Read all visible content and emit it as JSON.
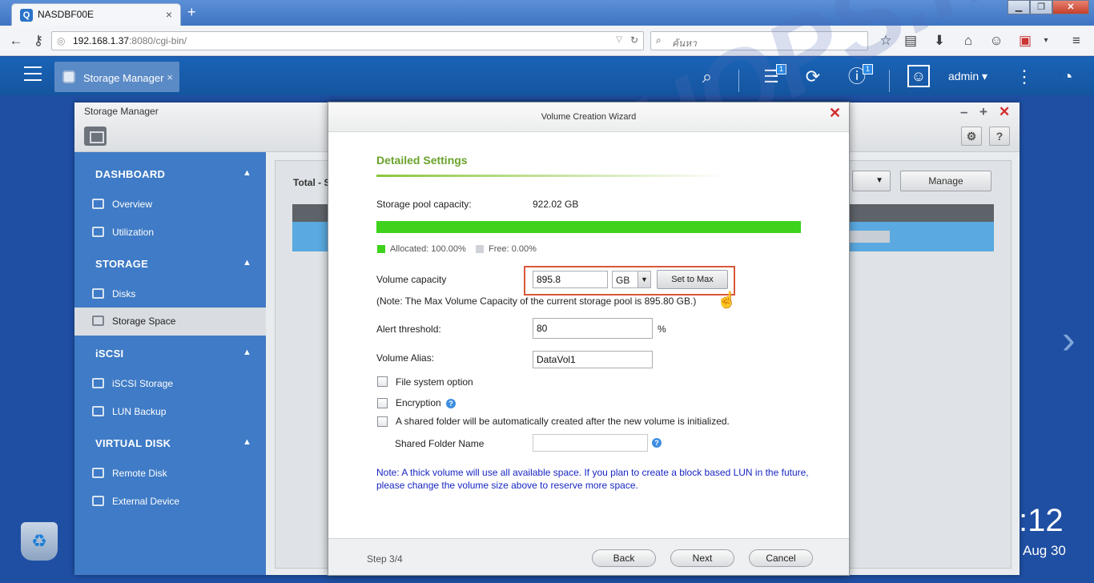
{
  "browser": {
    "tab_title": "NASDBF00E",
    "tab_close": "×",
    "new_tab": "+",
    "url_host": "192.168.1.37",
    "url_rest": ":8080/cgi-bin/",
    "search_placeholder": "ค้นหา",
    "window_buttons": [
      "▁",
      "❐",
      "✕"
    ]
  },
  "qts": {
    "app_tab_label": "Storage Manager",
    "app_tab_close": "×",
    "user": "admin ▾",
    "badges": [
      "1",
      "1"
    ]
  },
  "storage_manager": {
    "title": "Storage Manager",
    "total_label": "Total - St",
    "manage_label": "Manage",
    "dropdown_arrow": "▼",
    "window_controls": [
      "–",
      "+",
      "✕"
    ],
    "gear": "⚙",
    "help": "?",
    "sidebar": {
      "sections": [
        {
          "title": "DASHBOARD",
          "items": [
            "Overview",
            "Utilization"
          ]
        },
        {
          "title": "STORAGE",
          "items": [
            "Disks",
            "Storage Space"
          ]
        },
        {
          "title": "iSCSI",
          "items": [
            "iSCSI Storage",
            "LUN Backup"
          ]
        },
        {
          "title": "VIRTUAL DISK",
          "items": [
            "Remote Disk",
            "External Device"
          ]
        }
      ],
      "active_item": "Storage Space"
    }
  },
  "wizard": {
    "title": "Volume Creation Wizard",
    "close": "✕",
    "section_title": "Detailed Settings",
    "pool_capacity_label": "Storage pool capacity:",
    "pool_capacity_value": "922.02 GB",
    "allocated_fraction": 1.0,
    "allocated_label": "Allocated: 100.00%",
    "free_label": "Free: 0.00%",
    "volume_capacity_label": "Volume capacity",
    "volume_capacity_value": "895.8",
    "unit_value": "GB",
    "unit_arrow": "▼",
    "set_to_max_label": "Set to Max",
    "max_note": "(Note: The Max Volume Capacity of the current storage pool is 895.80 GB.)",
    "alert_label": "Alert threshold:",
    "alert_value": "80",
    "alert_unit": "%",
    "alias_label": "Volume Alias:",
    "alias_value": "DataVol1",
    "fs_option_label": "File system option",
    "encryption_label": "Encryption",
    "shared_folder_option_label": "A shared folder will be automatically created after the new volume is initialized.",
    "shared_folder_name_label": "Shared Folder Name",
    "shared_folder_name_value": "",
    "help_glyph": "?",
    "thick_note": "Note: A thick volume will use all available space. If you plan to create a block based LUN in the future, please change the volume size above to reserve more space.",
    "step_label": "Step 3/4",
    "back_label": "Back",
    "next_label": "Next",
    "cancel_label": "Cancel"
  },
  "desktop": {
    "clock": ":12",
    "date": "Aug 30",
    "watermark": "NASSHOPS.net"
  },
  "colors": {
    "qts_blue": "#1a63b6",
    "sidebar_blue": "#3f7bc6",
    "accent_green": "#6aa22c",
    "bar_green": "#3ed21c",
    "highlight_red": "#d9573a",
    "note_blue": "#1826c2"
  }
}
